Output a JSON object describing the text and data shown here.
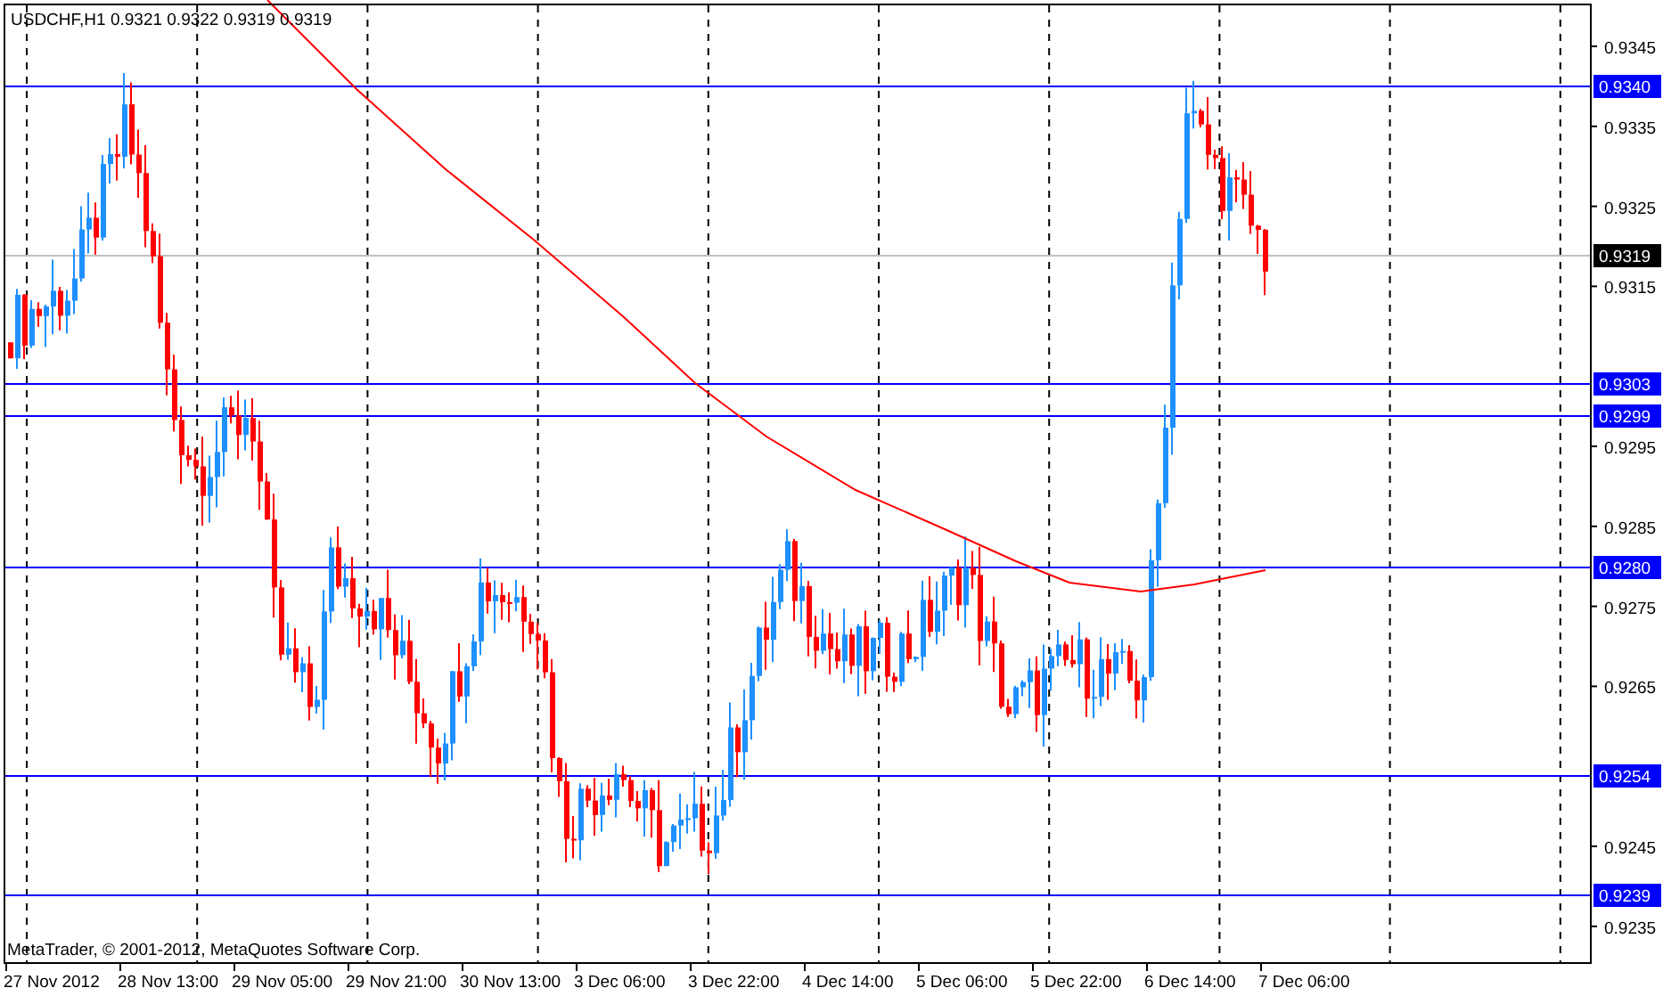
{
  "header": {
    "symbol": "USDCHF,H1",
    "quotes": [
      "0.9321",
      "0.9322",
      "0.9319",
      "0.9319"
    ]
  },
  "price_axis": {
    "ticks": [
      "0.9345",
      "0.9335",
      "0.9325",
      "0.9315",
      "0.9295",
      "0.9285",
      "0.9275",
      "0.9265",
      "0.9245",
      "0.9235"
    ]
  },
  "levels": [
    {
      "label": "0.9340",
      "kind": "level"
    },
    {
      "label": "0.9319",
      "kind": "bid"
    },
    {
      "label": "0.9303",
      "kind": "level"
    },
    {
      "label": "0.9299",
      "kind": "level"
    },
    {
      "label": "0.9280",
      "kind": "level"
    },
    {
      "label": "0.9254",
      "kind": "level"
    },
    {
      "label": "0.9239",
      "kind": "level"
    }
  ],
  "time_axis": {
    "labels": [
      "27 Nov 2012",
      "28 Nov 13:00",
      "29 Nov 05:00",
      "29 Nov 21:00",
      "30 Nov 13:00",
      "3 Dec 06:00",
      "3 Dec 22:00",
      "4 Dec 14:00",
      "5 Dec 06:00",
      "5 Dec 22:00",
      "6 Dec 14:00",
      "7 Dec 06:00"
    ]
  },
  "copyright": "MetaTrader, © 2001-2012, MetaQuotes Software Corp."
}
